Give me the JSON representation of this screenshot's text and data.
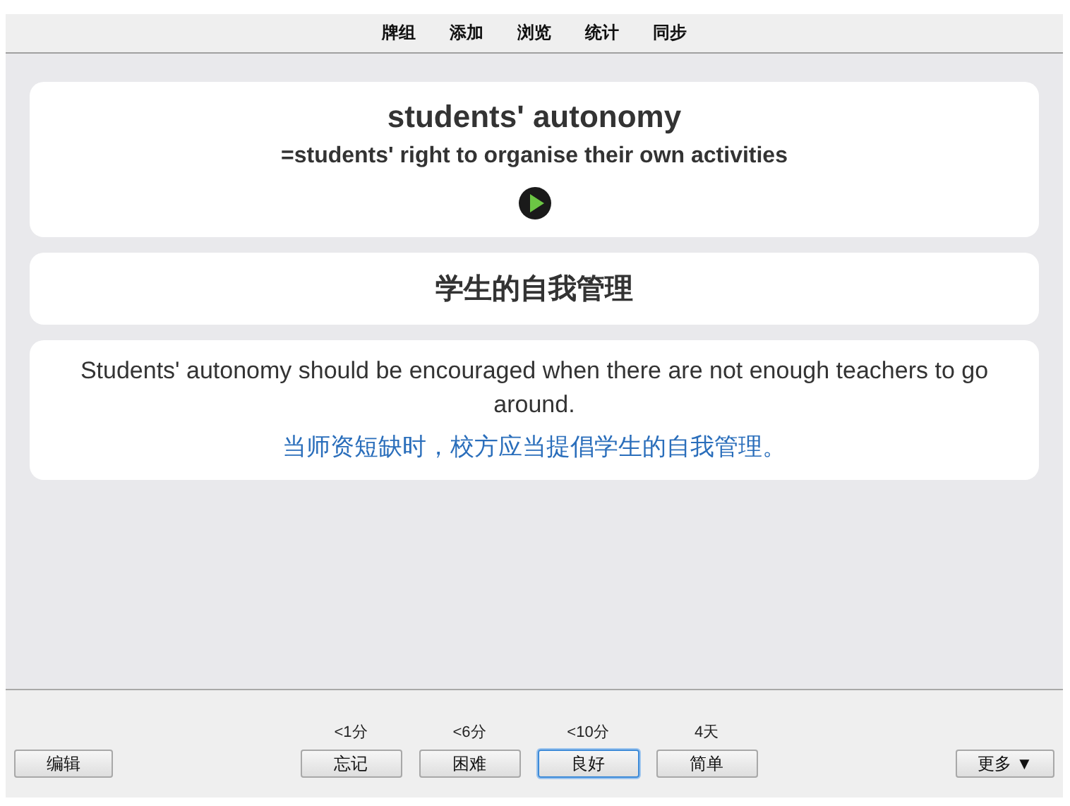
{
  "top_menu": [
    {
      "label": "牌组"
    },
    {
      "label": "添加"
    },
    {
      "label": "浏览"
    },
    {
      "label": "统计"
    },
    {
      "label": "同步"
    }
  ],
  "card": {
    "term": "students' autonomy",
    "definition": "=students' right to organise their own activities",
    "translation": "学生的自我管理",
    "example": "Students' autonomy should be encouraged when there are not enough teachers to go around.",
    "example_translation": "当师资短缺时，校方应当提倡学生的自我管理。"
  },
  "bottom_bar": {
    "edit_button": "编辑",
    "more_button": "更多 ▼",
    "answers": [
      {
        "interval": "<1分",
        "label": "忘记",
        "focused": false
      },
      {
        "interval": "<6分",
        "label": "困难",
        "focused": false
      },
      {
        "interval": "<10分",
        "label": "良好",
        "focused": true
      },
      {
        "interval": "4天",
        "label": "简单",
        "focused": false
      }
    ]
  }
}
